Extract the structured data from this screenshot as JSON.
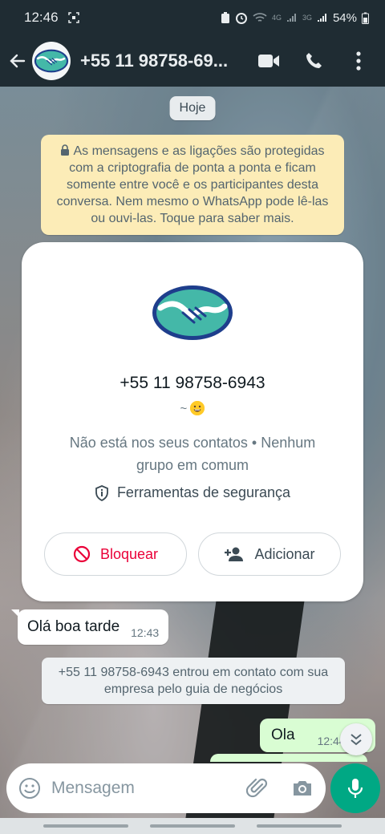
{
  "status_bar": {
    "time": "12:46",
    "battery": "54%",
    "net1": "4G",
    "net2": "3G"
  },
  "header": {
    "contact_name": "+55 11 98758-69...",
    "icons": [
      "back-arrow-icon",
      "video-call-icon",
      "voice-call-icon",
      "more-options-icon"
    ]
  },
  "chat": {
    "date_pill": "Hoje",
    "encryption_notice": "As mensagens e as ligações são protegidas com a criptografia de ponta a ponta e ficam somente entre você e os participantes desta conversa. Nem mesmo o WhatsApp pode lê-las ou ouvi-las. Toque para saber mais.",
    "contact_card": {
      "phone": "+55 11 98758-6943",
      "about": "~",
      "info": "Não está nos seus contatos • Nenhum grupo em comum",
      "safety_label": "Ferramentas de segurança",
      "block_label": "Bloquear",
      "add_label": "Adicionar"
    },
    "messages": [
      {
        "direction": "in",
        "text": "Olá boa tarde",
        "time": "12:43"
      },
      {
        "direction": "out",
        "text": "Ola",
        "time": "12:44"
      }
    ],
    "system_message": "+55 11 98758-6943 entrou em contato com sua empresa pelo guia de negócios"
  },
  "composer": {
    "placeholder": "Mensagem"
  },
  "colors": {
    "header_bg": "#1f2c33",
    "accent": "#00a884",
    "block_red": "#ea0038",
    "outgoing_bubble": "#d9fdd3",
    "encryption_bg": "#fcecb7"
  }
}
